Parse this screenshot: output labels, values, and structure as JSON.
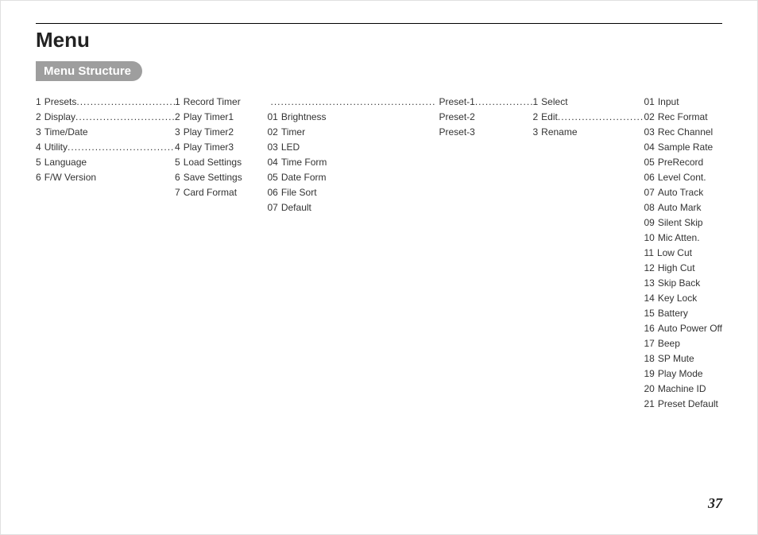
{
  "title": "Menu",
  "section": "Menu Structure",
  "pageNumber": "37",
  "col1": [
    {
      "num": "1",
      "label": "Presets",
      "dots": true
    },
    {
      "num": "2",
      "label": "Display",
      "dots": true
    },
    {
      "num": "3",
      "label": "Time/Date",
      "dots": false
    },
    {
      "num": "4",
      "label": "Utility",
      "dots": true
    },
    {
      "num": "5",
      "label": "Language",
      "dots": false
    },
    {
      "num": "6",
      "label": "F/W Version",
      "dots": false
    }
  ],
  "col2": [
    {
      "num": "",
      "label": "",
      "dots": false
    },
    {
      "num": "",
      "label": "",
      "dots": false
    },
    {
      "num": "",
      "label": "",
      "dots": false
    },
    {
      "num": "1",
      "label": "Record Timer",
      "dots": false
    },
    {
      "num": "2",
      "label": "Play Timer1",
      "dots": false
    },
    {
      "num": "3",
      "label": "Play Timer2",
      "dots": false
    },
    {
      "num": "4",
      "label": "Play Timer3",
      "dots": false
    },
    {
      "num": "5",
      "label": "Load Settings",
      "dots": false
    },
    {
      "num": "6",
      "label": "Save Settings",
      "dots": false
    },
    {
      "num": "7",
      "label": "Card Format",
      "dots": false
    }
  ],
  "col3": [
    {
      "num": "",
      "label": "",
      "dots": true
    },
    {
      "num": "01",
      "label": "Brightness",
      "dots": false
    },
    {
      "num": "02",
      "label": "Timer",
      "dots": false
    },
    {
      "num": "03",
      "label": "LED",
      "dots": false
    },
    {
      "num": "04",
      "label": "Time Form",
      "dots": false
    },
    {
      "num": "05",
      "label": "Date Form",
      "dots": false
    },
    {
      "num": "06",
      "label": "File Sort",
      "dots": false
    },
    {
      "num": "07",
      "label": "Default",
      "dots": false
    }
  ],
  "col4": [
    {
      "num": "",
      "label": "Preset-1",
      "dots": true
    },
    {
      "num": "",
      "label": "Preset-2",
      "dots": false
    },
    {
      "num": "",
      "label": "Preset-3",
      "dots": false
    }
  ],
  "col5": [
    {
      "num": "1",
      "label": "Select",
      "dots": false
    },
    {
      "num": "2",
      "label": "Edit",
      "dots": true
    },
    {
      "num": "3",
      "label": "Rename",
      "dots": false
    }
  ],
  "col6": [
    {
      "num": "",
      "label": "",
      "dots": false
    },
    {
      "num": "01",
      "label": "Input",
      "dots": false
    },
    {
      "num": "02",
      "label": "Rec Format",
      "dots": false
    },
    {
      "num": "03",
      "label": "Rec Channel",
      "dots": false
    },
    {
      "num": "04",
      "label": "Sample Rate",
      "dots": false
    },
    {
      "num": "05",
      "label": "PreRecord",
      "dots": false
    },
    {
      "num": "06",
      "label": "Level Cont.",
      "dots": false
    },
    {
      "num": "07",
      "label": "Auto Track",
      "dots": false
    },
    {
      "num": "08",
      "label": "Auto Mark",
      "dots": false
    },
    {
      "num": "09",
      "label": "Silent Skip",
      "dots": false
    },
    {
      "num": "10",
      "label": "Mic Atten.",
      "dots": false
    },
    {
      "num": "11",
      "label": "Low Cut",
      "dots": false
    },
    {
      "num": "12",
      "label": "High Cut",
      "dots": false
    },
    {
      "num": "13",
      "label": "Skip Back",
      "dots": false
    },
    {
      "num": "14",
      "label": "Key Lock",
      "dots": false
    },
    {
      "num": "15",
      "label": "Battery",
      "dots": false
    },
    {
      "num": "16",
      "label": "Auto Power Off",
      "dots": false
    },
    {
      "num": "17",
      "label": "Beep",
      "dots": false
    },
    {
      "num": "18",
      "label": "SP Mute",
      "dots": false
    },
    {
      "num": "19",
      "label": "Play Mode",
      "dots": false
    },
    {
      "num": "20",
      "label": "Machine ID",
      "dots": false
    },
    {
      "num": "21",
      "label": "Preset Default",
      "dots": false
    }
  ]
}
